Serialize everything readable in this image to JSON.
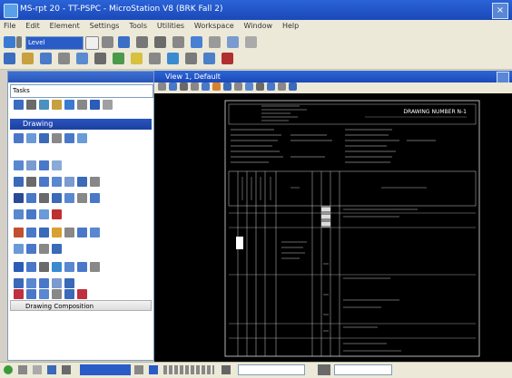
{
  "window": {
    "title": "MS-rpt 20 - TT-PSPC - MicroStation V8 (BRK Fall 2)"
  },
  "menu": {
    "items": [
      "File",
      "Edit",
      "Element",
      "Settings",
      "Tools",
      "Utilities",
      "Workspace",
      "Window",
      "Help"
    ]
  },
  "toolbar": {
    "level_combo": "Level"
  },
  "tasks": {
    "combo_label": "Tasks",
    "drawing_header": "Drawing",
    "drawing_composition": "Drawing Composition"
  },
  "view": {
    "title": "View 1, Default"
  },
  "sheet": {
    "drawing_number": "DRAWING NUMBER N-1"
  },
  "colors": {
    "title_blue": "#1b49b8",
    "panel_header": "#2a55c0",
    "canvas": "#000000"
  }
}
